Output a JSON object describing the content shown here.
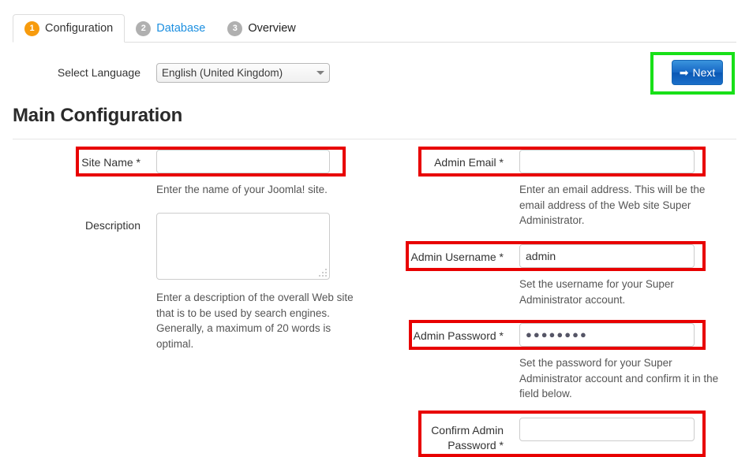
{
  "tabs": [
    {
      "number": "1",
      "label": "Configuration",
      "state": "active"
    },
    {
      "number": "2",
      "label": "Database",
      "state": "link"
    },
    {
      "number": "3",
      "label": "Overview",
      "state": "inactive"
    }
  ],
  "language": {
    "label": "Select Language",
    "selected": "English (United Kingdom)"
  },
  "next_button": {
    "label": "Next",
    "arrow": "➡",
    "annotation_color": "#18e018"
  },
  "page_title": "Main Configuration",
  "annotation_color_red": "#e80000",
  "left_column": {
    "site_name": {
      "label": "Site Name *",
      "value": "",
      "placeholder": "",
      "help": "Enter the name of your Joomla! site."
    },
    "description": {
      "label": "Description",
      "value": "",
      "placeholder": "",
      "help": "Enter a description of the overall Web site that is to be used by search engines. Generally, a maximum of 20 words is optimal."
    }
  },
  "right_column": {
    "admin_email": {
      "label": "Admin Email *",
      "value": "",
      "placeholder": "",
      "help": "Enter an email address. This will be the email address of the Web site Super Administrator."
    },
    "admin_username": {
      "label": "Admin Username *",
      "value": "admin",
      "placeholder": "",
      "help": "Set the username for your Super Administrator account."
    },
    "admin_password": {
      "label": "Admin Password *",
      "value": "●●●●●●●●",
      "placeholder": "",
      "help": "Set the password for your Super Administrator account and confirm it in the field below."
    },
    "confirm_admin_password": {
      "label_line1": "Confirm Admin",
      "label_line2": "Password *",
      "value": "",
      "placeholder": "",
      "help": ""
    }
  }
}
